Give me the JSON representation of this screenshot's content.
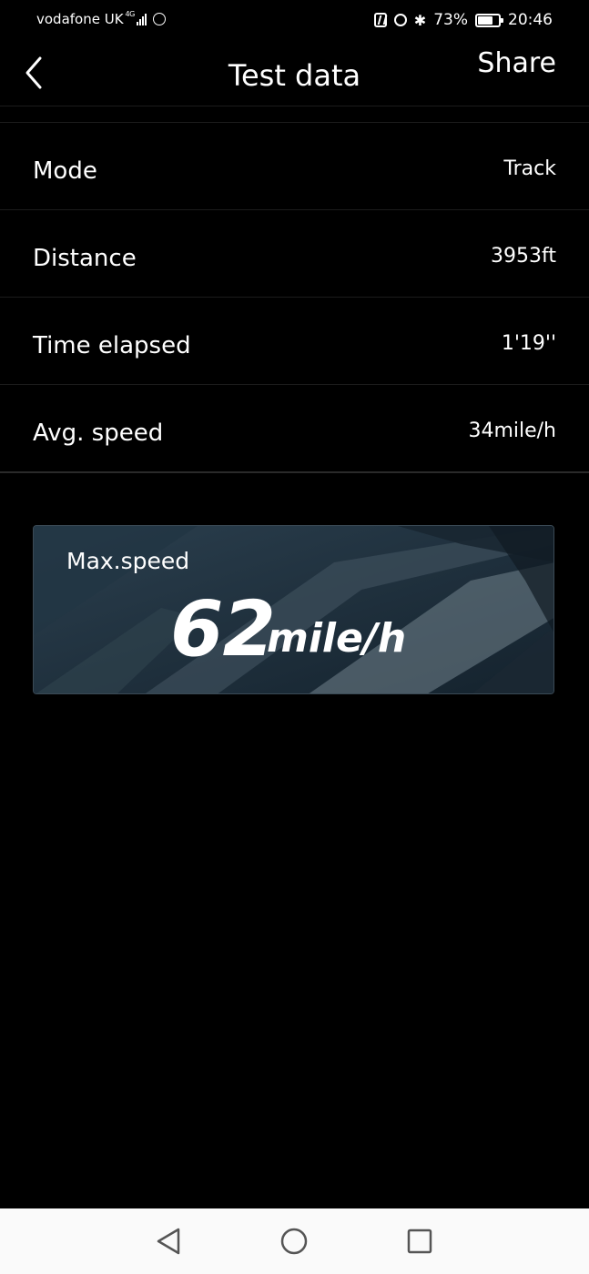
{
  "status_bar": {
    "carrier": "vodafone UK",
    "network": "4G",
    "battery": "73%",
    "battery_level": 0.73,
    "time": "20:46",
    "icons": [
      "signal-icon",
      "hotspot-icon",
      "nfc-icon",
      "alarm-icon",
      "bluetooth-icon",
      "battery-icon"
    ]
  },
  "header": {
    "title": "Test data",
    "share_label": "Share",
    "back_icon": "chevron-left-icon"
  },
  "rows": [
    {
      "label": "Mode",
      "value": "Track"
    },
    {
      "label": "Distance",
      "value": "3953ft"
    },
    {
      "label": "Time elapsed",
      "value": "1'19''"
    },
    {
      "label": "Avg. speed",
      "value": "34mile/h"
    }
  ],
  "max_speed": {
    "label": "Max.speed",
    "value": "62",
    "unit": "mile/h"
  },
  "nav_bar": {
    "icons": [
      "back-triangle-icon",
      "home-circle-icon",
      "recents-square-icon"
    ]
  }
}
